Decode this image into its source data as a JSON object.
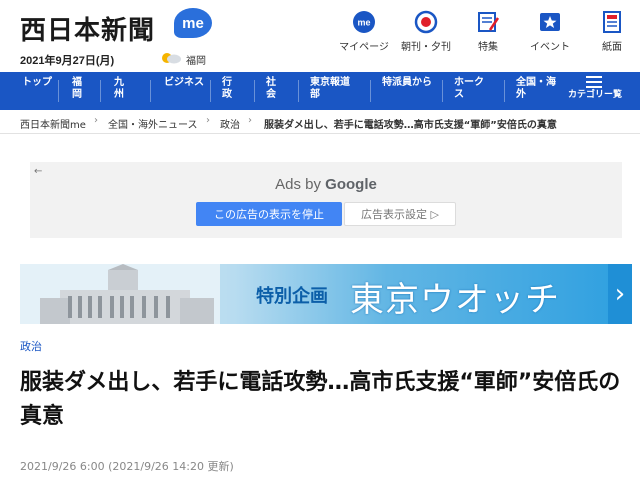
{
  "header": {
    "logo_text": "西日本新聞",
    "logo_me": "me",
    "date": "2021年9月27日(月)",
    "weather_city": "福岡",
    "nav_icons": [
      {
        "label": "マイページ",
        "icon": "me-icon"
      },
      {
        "label": "朝刊・夕刊",
        "icon": "newspaper-edition-icon"
      },
      {
        "label": "特集",
        "icon": "feature-icon"
      },
      {
        "label": "イベント",
        "icon": "event-star-icon"
      },
      {
        "label": "紙面",
        "icon": "paper-icon"
      }
    ]
  },
  "navbar": {
    "items": [
      {
        "label": "トップ"
      },
      {
        "label": "福岡"
      },
      {
        "label": "九州"
      },
      {
        "label": "ビジネス"
      },
      {
        "label": "行政"
      },
      {
        "label": "社会"
      },
      {
        "label": "東京報道部"
      },
      {
        "label": "特派員から"
      },
      {
        "label": "ホークス"
      },
      {
        "label": "全国・海外"
      }
    ],
    "categories_label": "カテゴリー覧",
    "bg_color": "#1a56c4"
  },
  "breadcrumb": {
    "items": [
      "西日本新聞me",
      "全国・海外ニュース",
      "政治",
      "服装ダメ出し、若手に電話攻勢…高市氏支援“軍師”安倍氏の真意"
    ]
  },
  "ad": {
    "back": "←",
    "ads_by": "Ads by",
    "google": "Google",
    "stop_label": "この広告の表示を停止",
    "settings_label": "広告表示設定 ▷"
  },
  "banner": {
    "special": "特別企画",
    "title": "東京ウオッチ",
    "arrow": "›"
  },
  "article": {
    "category": "政治",
    "headline": "服装ダメ出し、若手に電話攻勢…高市氏支援“軍師”安倍氏の真意",
    "published": "2021/9/26 6:00 (2021/9/26 14:20 更新)"
  }
}
